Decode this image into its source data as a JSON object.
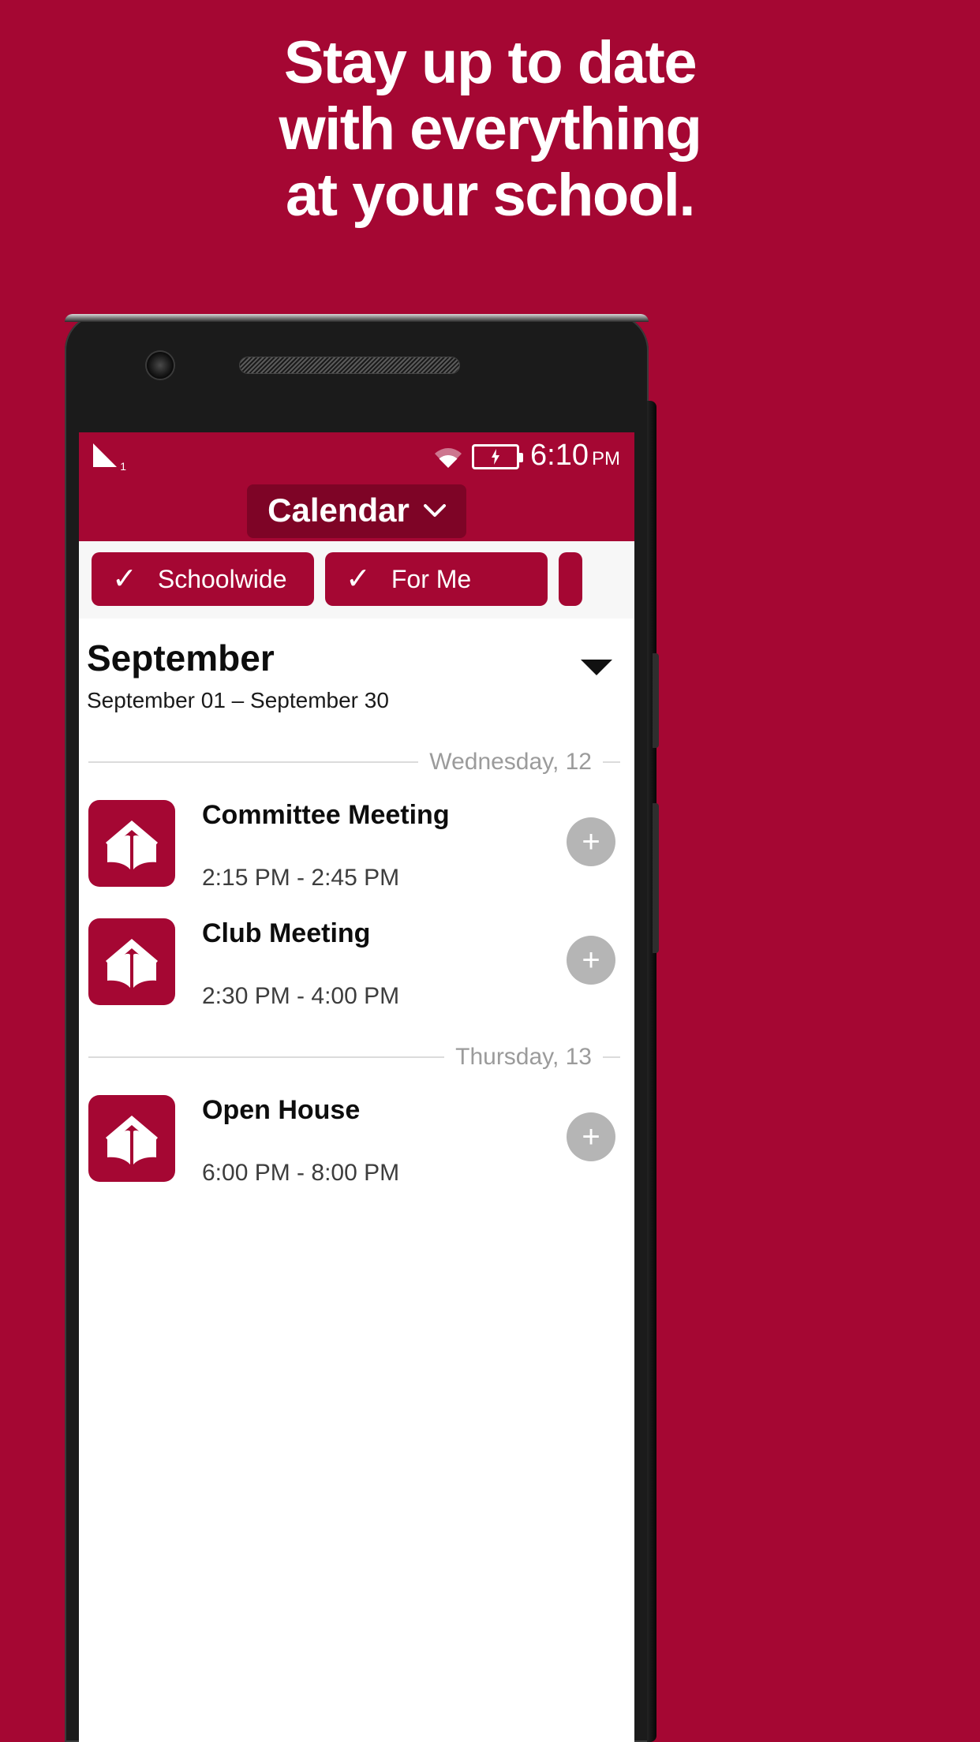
{
  "promo": {
    "headline_lines": [
      "Stay up to date",
      "with everything",
      "at your school."
    ],
    "background_color": "#A50733"
  },
  "phone": {
    "front_camera_icon": "camera-icon",
    "earpiece_icon": "speaker-grill-icon"
  },
  "statusbar": {
    "signal_icon": "signal-bars-icon",
    "signal_slot": "1",
    "wifi_icon": "wifi-icon",
    "battery_icon": "battery-charging-icon",
    "time": "6:10",
    "meridiem": "PM"
  },
  "appbar": {
    "title": "Calendar",
    "dropdown_icon": "chevron-down-icon",
    "accent_color": "#A50733",
    "pill_color": "#7E0426"
  },
  "filters": [
    {
      "label": "Schoolwide",
      "check_icon": "check-icon",
      "selected": "true"
    },
    {
      "label": "For Me",
      "check_icon": "check-icon",
      "selected": "true"
    }
  ],
  "month_header": {
    "title": "September",
    "range": "September 01 – September 30",
    "expand_icon": "caret-down-icon"
  },
  "days": [
    {
      "label": "Wednesday, 12",
      "events": [
        {
          "icon": "school-book-icon",
          "title": "Committee Meeting",
          "time": "2:15 PM - 2:45 PM",
          "add_icon": "plus-icon"
        },
        {
          "icon": "school-book-icon",
          "title": "Club Meeting",
          "time": "2:30 PM - 4:00 PM",
          "add_icon": "plus-icon"
        }
      ]
    },
    {
      "label": "Thursday, 13",
      "events": [
        {
          "icon": "school-book-icon",
          "title": "Open House",
          "time": "6:00 PM - 8:00 PM",
          "add_icon": "plus-icon"
        }
      ]
    }
  ]
}
